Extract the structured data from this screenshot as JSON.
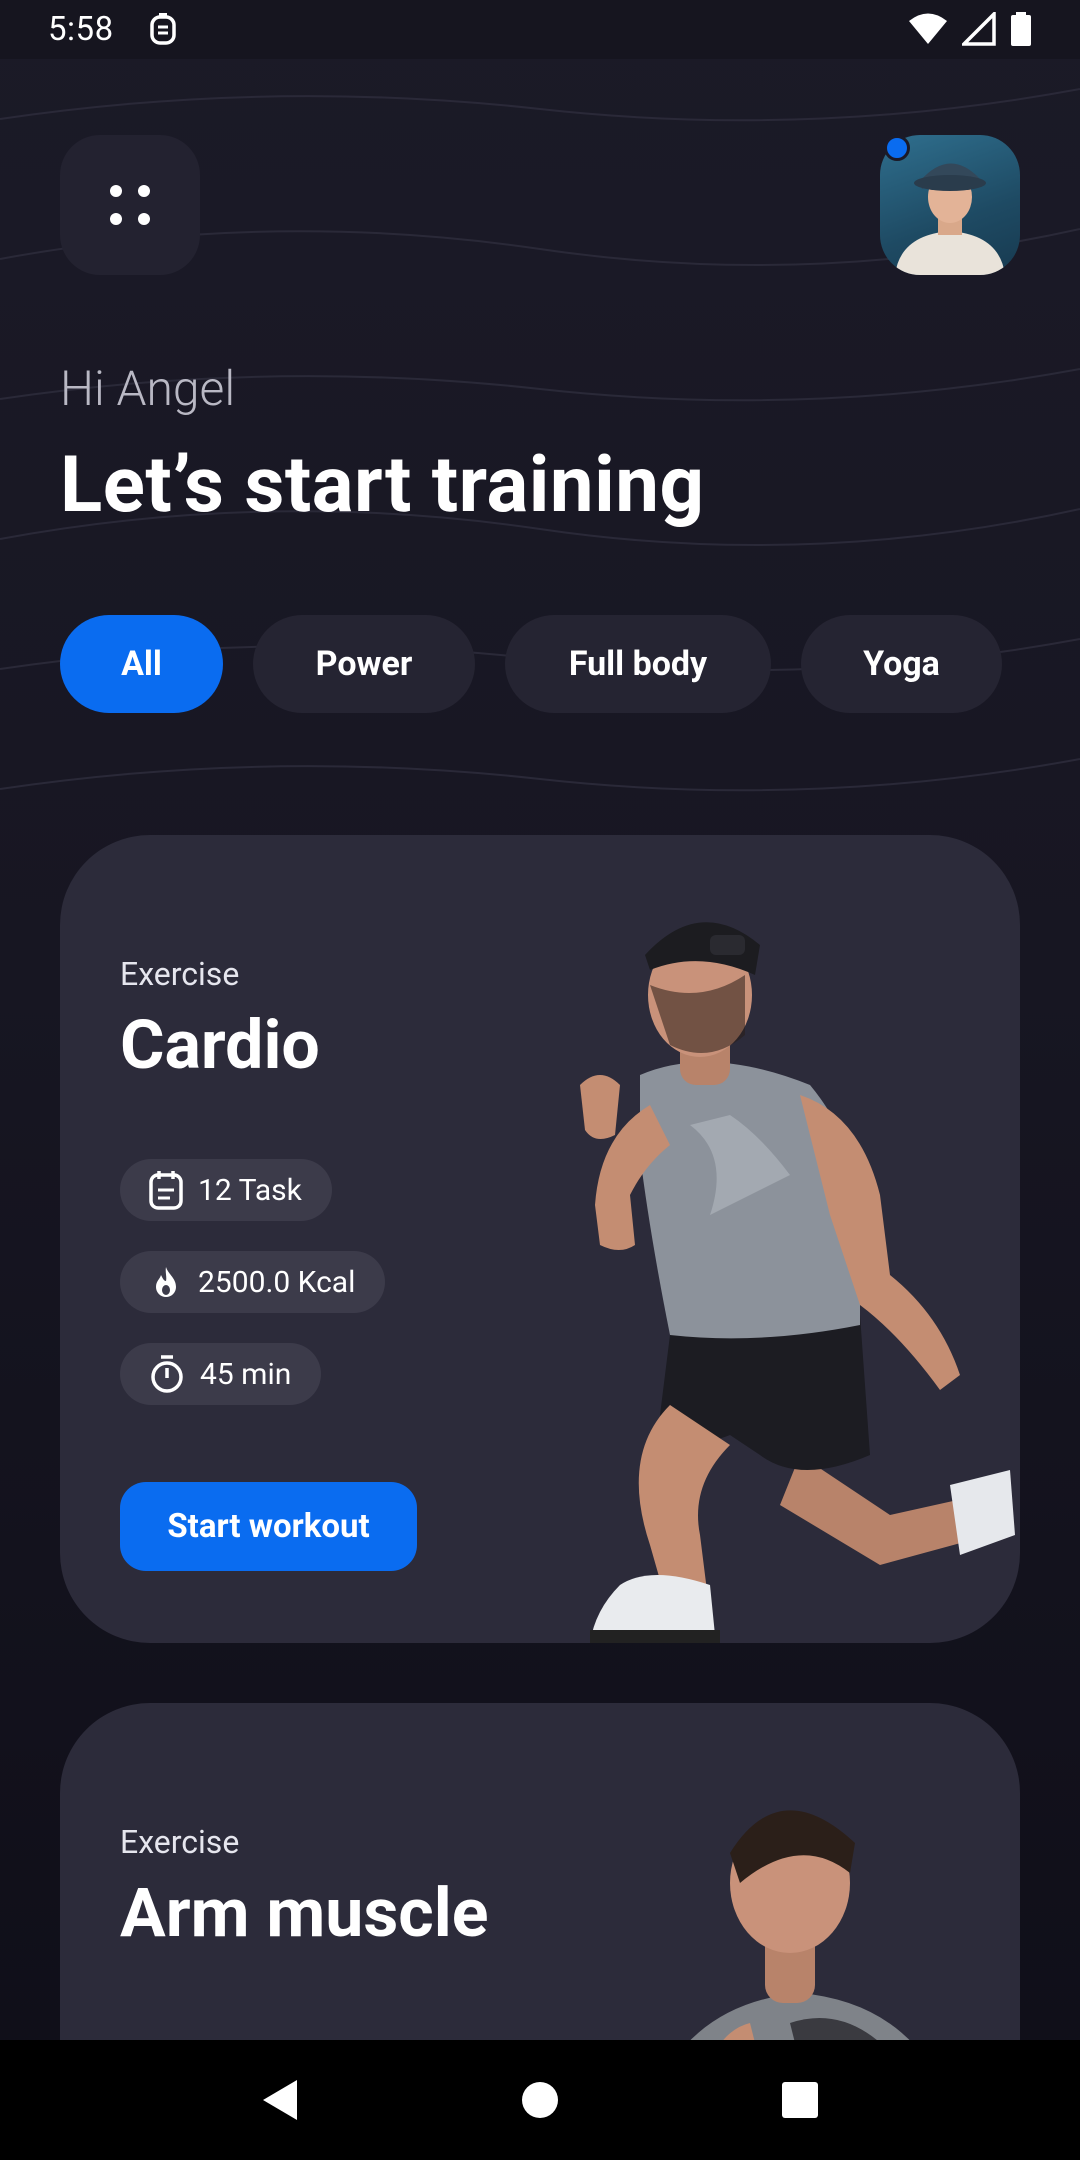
{
  "status_bar": {
    "time": "5:58",
    "icons": [
      "debug-app-icon",
      "wifi-icon",
      "signal-icon",
      "battery-icon"
    ]
  },
  "header": {
    "menu_icon": "grid-dots-icon",
    "avatar_alt": "profile-avatar",
    "has_notification_dot": true
  },
  "greeting": "Hi Angel",
  "headline": "Let’s start training",
  "filters": [
    {
      "label": "All",
      "active": true
    },
    {
      "label": "Power",
      "active": false
    },
    {
      "label": "Full body",
      "active": false
    },
    {
      "label": "Yoga",
      "active": false
    }
  ],
  "cards": [
    {
      "label": "Exercise",
      "title": "Cardio",
      "stats": [
        {
          "icon": "calendar-task-icon",
          "text": "12 Task"
        },
        {
          "icon": "flame-icon",
          "text": "2500.0 Kcal"
        },
        {
          "icon": "stopwatch-icon",
          "text": "45 min"
        }
      ],
      "button": "Start workout"
    },
    {
      "label": "Exercise",
      "title": "Arm muscle"
    }
  ],
  "nav_bar": [
    "back-icon",
    "home-icon",
    "recents-icon"
  ],
  "colors": {
    "accent": "#0a6cf0",
    "background": "#1b1a27",
    "card": "#2c2b3a",
    "chip": "#252432",
    "stat_pill": "#3c3b4a"
  }
}
